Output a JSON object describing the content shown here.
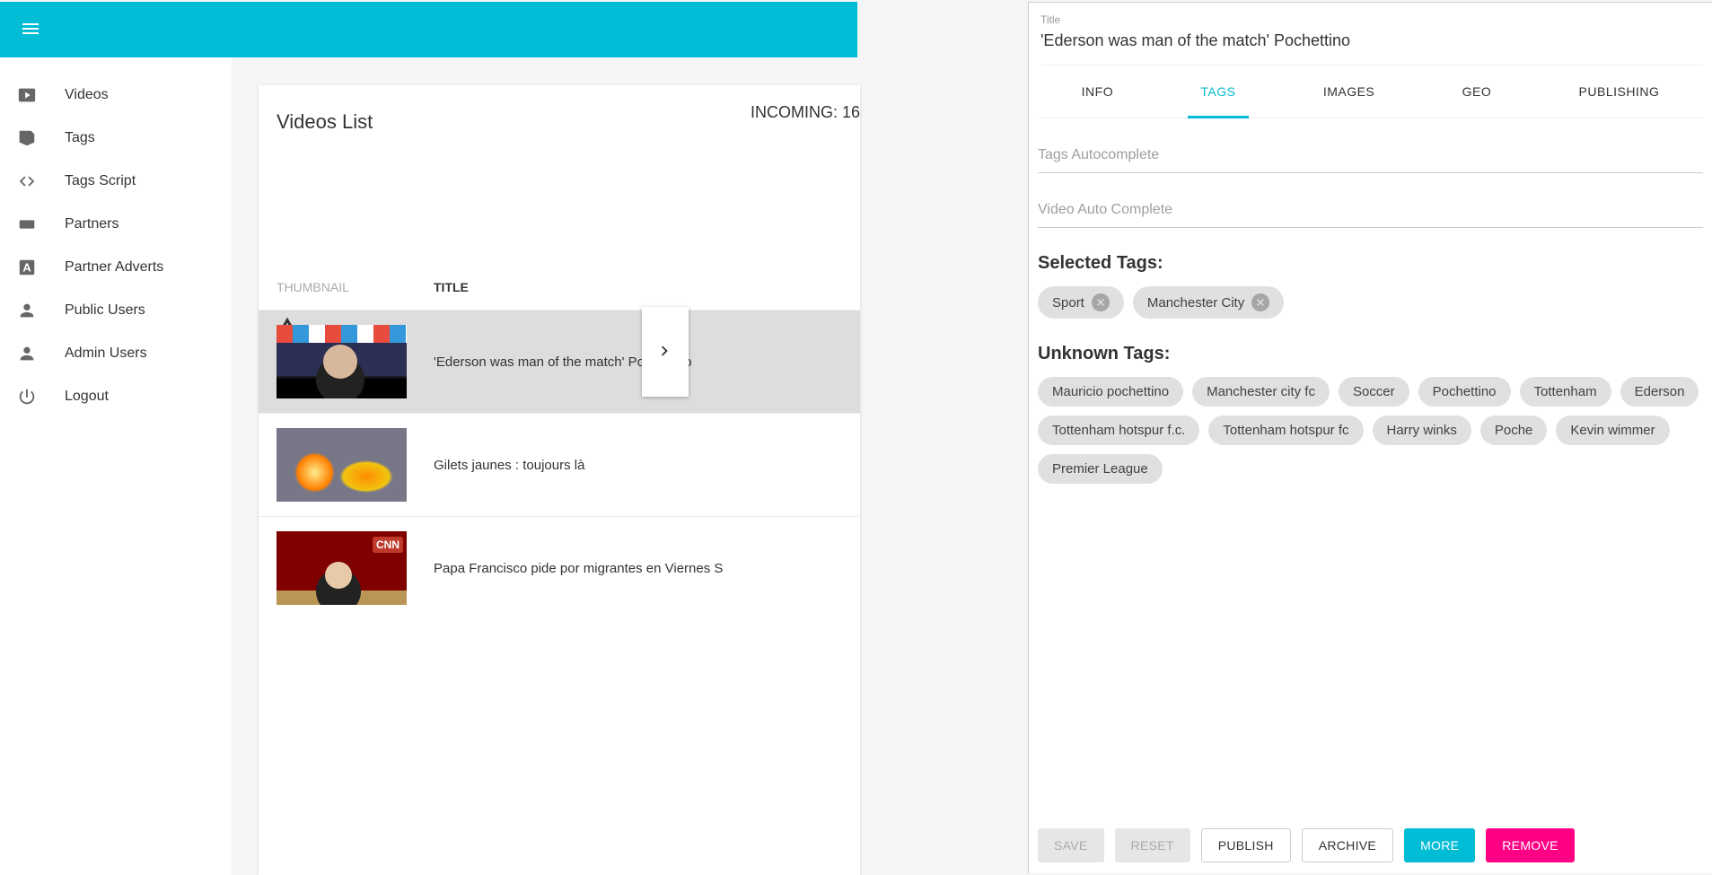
{
  "sidebar": {
    "items": [
      {
        "label": "Videos"
      },
      {
        "label": "Tags"
      },
      {
        "label": "Tags Script"
      },
      {
        "label": "Partners"
      },
      {
        "label": "Partner Adverts"
      },
      {
        "label": "Public Users"
      },
      {
        "label": "Admin Users"
      },
      {
        "label": "Logout"
      }
    ]
  },
  "main": {
    "title": "Videos List",
    "incoming": "INCOMING: 16",
    "columns": {
      "thumbnail": "THUMBNAIL",
      "title": "TITLE"
    },
    "rows": [
      {
        "title": "'Ederson was man of the match' Pochettino"
      },
      {
        "title": "Gilets jaunes : toujours là"
      },
      {
        "title": "Papa Francisco pide por migrantes en Viernes S"
      }
    ]
  },
  "drawer": {
    "title_label": "Title",
    "title_value": "'Ederson was man of the match' Pochettino",
    "tabs": [
      "INFO",
      "TAGS",
      "IMAGES",
      "GEO",
      "PUBLISHING"
    ],
    "active_tab": "TAGS",
    "inputs": {
      "tags_autocomplete_placeholder": "Tags Autocomplete",
      "video_autocomplete_placeholder": "Video Auto Complete"
    },
    "selected_tags_label": "Selected Tags:",
    "selected_tags": [
      "Sport",
      "Manchester City"
    ],
    "unknown_tags_label": "Unknown Tags:",
    "unknown_tags": [
      "Mauricio pochettino",
      "Manchester city fc",
      "Soccer",
      "Pochettino",
      "Tottenham",
      "Ederson",
      "Tottenham hotspur f.c.",
      "Tottenham hotspur fc",
      "Harry winks",
      "Poche",
      "Kevin wimmer",
      "Premier League"
    ],
    "actions": {
      "save": "SAVE",
      "reset": "RESET",
      "publish": "PUBLISH",
      "archive": "ARCHIVE",
      "more": "MORE",
      "remove": "REMOVE"
    }
  }
}
